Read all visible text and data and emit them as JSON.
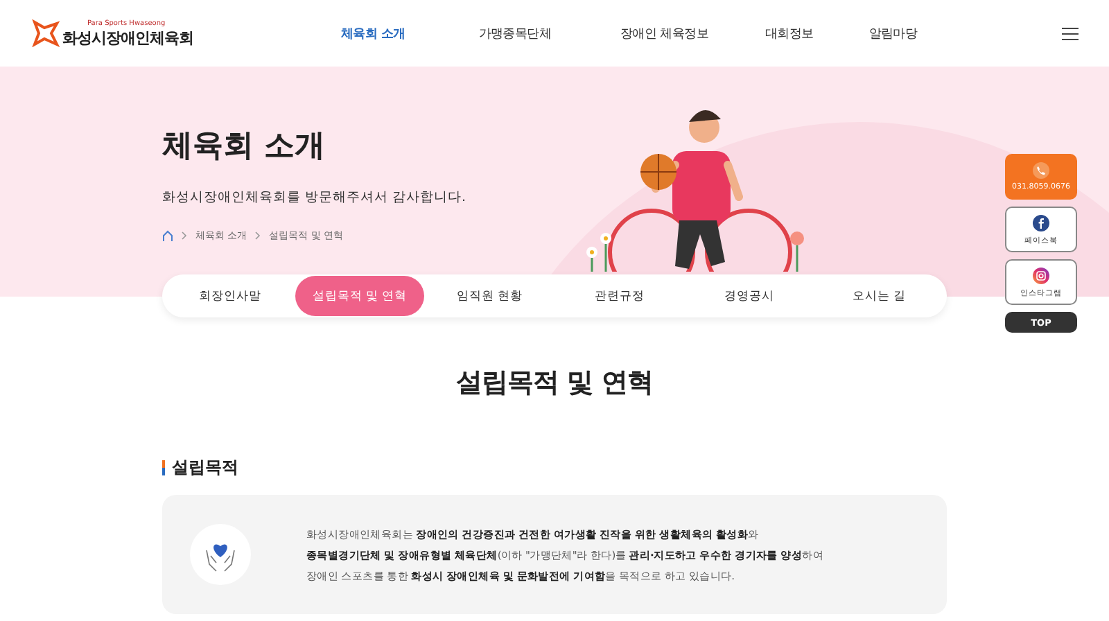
{
  "header": {
    "logo_text": "화성시장애인체육회",
    "logo_tagline": "Para Sports Hwaseong",
    "nav": [
      {
        "label": "체육회 소개",
        "selected": true
      },
      {
        "label": "가맹종목단체",
        "selected": false
      },
      {
        "label": "장애인 체육정보",
        "selected": false
      },
      {
        "label": "대회정보",
        "selected": false
      },
      {
        "label": "알림마당",
        "selected": false
      }
    ]
  },
  "hero": {
    "title": "체육회 소개",
    "subtitle": "화성시장애인체육회를 방문해주셔서 감사합니다.",
    "breadcrumb": [
      "체육회 소개",
      "설립목적 및 연혁"
    ]
  },
  "tabs": [
    {
      "label": "회장인사말",
      "selected": false
    },
    {
      "label": "설립목적 및 연혁",
      "selected": true
    },
    {
      "label": "임직원 현황",
      "selected": false
    },
    {
      "label": "관련규정",
      "selected": false
    },
    {
      "label": "경영공시",
      "selected": false
    },
    {
      "label": "오시는 길",
      "selected": false
    }
  ],
  "page_title": "설립목적 및 연혁",
  "section": {
    "heading": "설립목적",
    "lines": [
      "화성시장애인체육회는 **장애인의 건강증진과 건전한 여가생활 진작을 위한 생활체육의 활성화**와",
      "**종목별경기단체 및 장애유형별 체육단체**(이하 \"가맹단체\"라 한다)를 **관리·지도하고 우수한 경기자를 양성**하여",
      "장애인 스포츠를 통한 **화성시 장애인체육 및 문화발전에 기여함**을 목적으로 하고 있습니다."
    ]
  },
  "quick_menu": [
    {
      "kind": "phone",
      "label": "031.8059.0676"
    },
    {
      "kind": "facebook",
      "label": "페이스북"
    },
    {
      "kind": "instagram",
      "label": "인스타그램"
    },
    {
      "kind": "top",
      "label": "TOP"
    }
  ]
}
